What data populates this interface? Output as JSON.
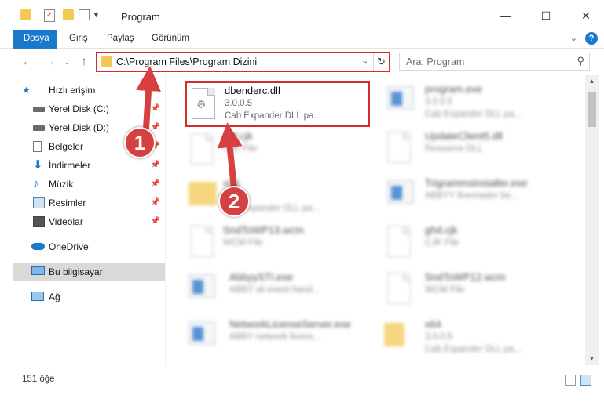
{
  "window": {
    "title": "Program"
  },
  "ribbon": {
    "tabs": [
      "Dosya",
      "Giriş",
      "Paylaş",
      "Görünüm"
    ]
  },
  "address": {
    "path": "C:\\Program Files\\Program Dizini"
  },
  "search": {
    "placeholder": "Ara: Program"
  },
  "sidebar": {
    "items": [
      {
        "label": "Hızlı erişim",
        "icon": "star-icon",
        "pinned": false
      },
      {
        "label": "Yerel Disk (C:)",
        "icon": "drive-icon",
        "pinned": true
      },
      {
        "label": "Yerel Disk (D:)",
        "icon": "drive-icon",
        "pinned": true
      },
      {
        "label": "Belgeler",
        "icon": "documents-icon",
        "pinned": true
      },
      {
        "label": "İndirmeler",
        "icon": "download-icon",
        "pinned": true
      },
      {
        "label": "Müzik",
        "icon": "music-icon",
        "pinned": true
      },
      {
        "label": "Resimler",
        "icon": "pictures-icon",
        "pinned": true
      },
      {
        "label": "Videolar",
        "icon": "videos-icon",
        "pinned": true
      },
      {
        "label": "OneDrive",
        "icon": "cloud-icon",
        "pinned": false
      },
      {
        "label": "Bu bilgisayar",
        "icon": "computer-icon",
        "pinned": false
      },
      {
        "label": "Ağ",
        "icon": "network-icon",
        "pinned": false
      }
    ]
  },
  "files": {
    "focus": {
      "name": "dbenderc.dll",
      "version": "3.0.0.5",
      "description": "Cab Expander DLL pa..."
    },
    "blurred": [
      {
        "name": "program.exe",
        "line2": "3.0.0.5",
        "line3": "Cab Expander DLL pa..."
      },
      {
        "name": "...d.cjk",
        "line2": "CJK File",
        "line3": ""
      },
      {
        "name": "UpdateClient5.dll",
        "line2": "Resource DLL",
        "line3": ""
      },
      {
        "name": "x86",
        "line2": "",
        "line3": "Cab Expander DLL pa..."
      },
      {
        "name": "Trigrammsinstaller.exe",
        "line2": "ABBYY finereader be...",
        "line3": ""
      },
      {
        "name": "SndToWP13.wcm",
        "line2": "WCM File",
        "line3": ""
      },
      {
        "name": "ghd.cjk",
        "line2": "CJK File",
        "line3": ""
      },
      {
        "name": "AbbyySTI.exe",
        "line2": "ABBY sti event hand...",
        "line3": ""
      },
      {
        "name": "SndToWP12.wcm",
        "line2": "WCM File",
        "line3": ""
      },
      {
        "name": "NetworkLicenseServer.exe",
        "line2": "ABBY network licens...",
        "line3": ""
      },
      {
        "name": "x64",
        "line2": "3.0.0.5",
        "line3": "Cab Expander DLL pa..."
      }
    ]
  },
  "status": {
    "item_count": "151 öğe"
  },
  "annotations": {
    "callout1": "1",
    "callout2": "2"
  },
  "colors": {
    "accent": "#1979ca",
    "highlight": "#d42c2c",
    "callout": "#d64040"
  }
}
